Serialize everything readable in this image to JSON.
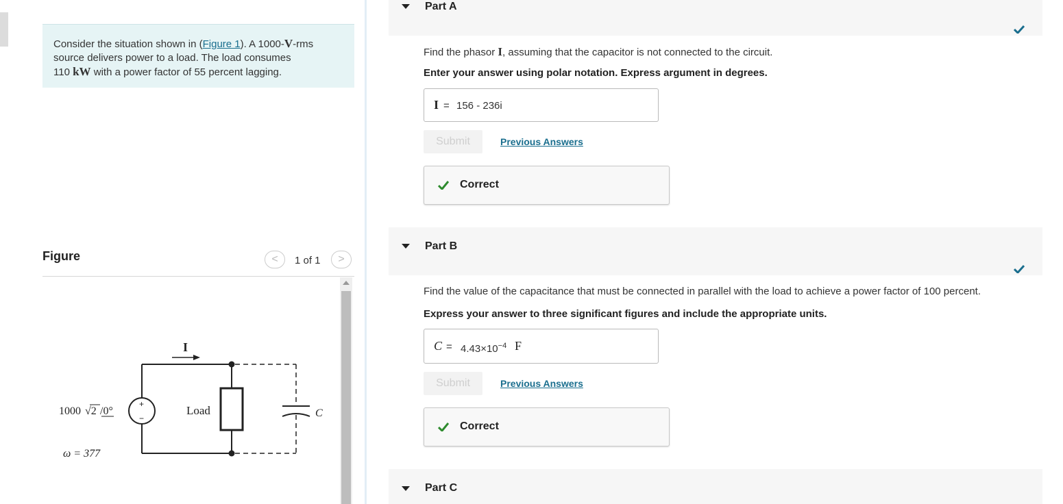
{
  "problem": {
    "text_before_link": "Consider the situation shown in (",
    "link_text": "Figure 1",
    "text_after_link": "). A 1000-",
    "unit_v": "V",
    "text_rms": "-rms",
    "line2": "source delivers power to a load. The load consumes",
    "power_value": "110",
    "power_unit": "kW",
    "line3_rest": "with a power factor of 55 percent lagging."
  },
  "figure": {
    "title": "Figure",
    "pager_prev": "<",
    "pager_count": "1 of 1",
    "pager_next": ">",
    "source_label": "1000",
    "source_sqrt": "√2",
    "source_angle": "/0°",
    "current_label": "I",
    "load_label": "Load",
    "cap_label": "C",
    "omega_label": "ω = 377",
    "plus": "+",
    "minus": "−"
  },
  "partA": {
    "label": "Part A",
    "question_before": "Find the phasor",
    "question_var": "I",
    "question_after": ", assuming that the capacitor is not connected to the circuit.",
    "instruction": "Enter your answer using polar notation. Express argument in degrees.",
    "answer_var": "I",
    "answer_eq": "=",
    "answer_value": "156 - 236i",
    "submit": "Submit",
    "previous_answers": "Previous Answers",
    "feedback": "Correct"
  },
  "partB": {
    "label": "Part B",
    "question": "Find the value of the capacitance that must be connected in parallel with the load to achieve a power factor of 100 percent.",
    "instruction": "Express your answer to three significant figures and include the appropriate units.",
    "answer_var": "C",
    "answer_eq": "=",
    "answer_mantissa": "4.43×10",
    "answer_exponent": "−4",
    "answer_unit": "F",
    "submit": "Submit",
    "previous_answers": "Previous Answers",
    "feedback": "Correct"
  },
  "partC": {
    "label": "Part C"
  },
  "colors": {
    "check_green": "#2e8b2e",
    "check_blue": "#1a6e8e",
    "link": "#1a6e8e",
    "intro_bg": "#e6f4f5"
  }
}
